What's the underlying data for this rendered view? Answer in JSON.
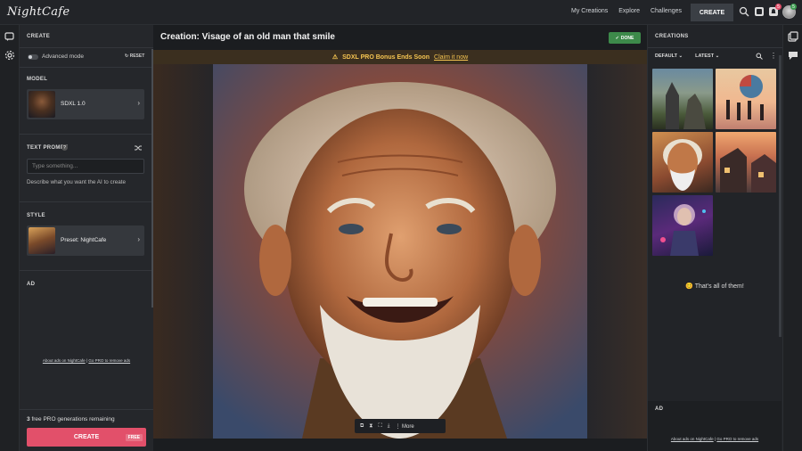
{
  "topbar": {
    "logo": "NightCafe",
    "nav": [
      "My Creations",
      "Explore",
      "Challenges"
    ],
    "create_label": "CREATE",
    "notification_count": "5",
    "profile_badge": "5",
    "icons": [
      "search-icon",
      "gallery-icon",
      "bell-icon",
      "avatar"
    ]
  },
  "left_panel": {
    "title": "CREATE",
    "advanced_mode": "Advanced mode",
    "reset": "RESET",
    "model": {
      "section": "MODEL",
      "name": "SDXL 1.0"
    },
    "prompt": {
      "section": "TEXT PROMPT",
      "help": "?",
      "placeholder": "Type something...",
      "hint": "Describe what you want the AI to create"
    },
    "style": {
      "section": "STYLE",
      "preset": "Preset: NightCafe"
    },
    "ad": {
      "section": "AD",
      "link1": "About ads on NightCafe",
      "sep": " | ",
      "link2": "Go PRO to remove ads"
    },
    "remaining_count": "3",
    "remaining_text": "free PRO generations remaining",
    "create_button": "CREATE",
    "free_tag": "FREE"
  },
  "center": {
    "title": "Creation: Visage of an old man that smile",
    "done": "DONE",
    "banner": {
      "text": "SDXL PRO Bonus Ends Soon",
      "link": "Claim it now"
    },
    "toolbar": {
      "more": "More"
    }
  },
  "right_panel": {
    "title": "CREATIONS",
    "filter1": "DEFAULT",
    "filter2": "LATEST",
    "end_text": "That's all of them!",
    "ad": {
      "section": "AD",
      "link1": "About ads on NightCafe",
      "sep": " | ",
      "link2": "Go PRO to remove ads"
    }
  },
  "colors": {
    "accent": "#e2506a",
    "done_green": "#3d8a4a",
    "banner_gold": "#f5c451"
  }
}
